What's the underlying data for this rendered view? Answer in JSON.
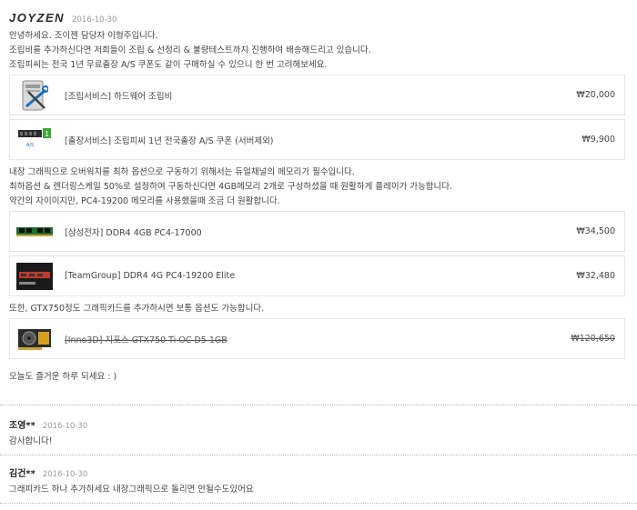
{
  "seller": {
    "logo": "JOYZEN",
    "date": "2016-10-30",
    "intro_lines": [
      "안녕하세요. 조이젠 담당자 이형주입니다.",
      "조립비를 추가하신다면 저희들이 조립 & 선정리 & 불량테스트까지 진행하여 배송해드리고 있습니다.",
      "조립피씨는 전국 1년 무료출장 A/S 쿠폰도 같이 구매하실 수 있으니 한 번 고려해보세요."
    ],
    "service_products": [
      {
        "name": "[조립서비스] 하드웨어 조립비",
        "price": "₩20,000",
        "icon": "assembly-tools-icon"
      },
      {
        "name": "[출장서비스] 조립피씨 1년 전국출장 A/S 쿠폰 (서버제외)",
        "price": "₩9,900",
        "icon": "as-coupon-icon"
      }
    ],
    "memory_lines": [
      "내장 그래픽으로 오버워치를 최하 옵션으로 구동하기 위해서는 듀얼채널의 메모리가 필수입니다.",
      "최하옵션 & 렌더링스케일 50%로 설정하여 구동하신다면 4GB메모리 2개로 구성하셨을 때 원활하게 플레이가 가능합니다.",
      "약간의 자이이지만, PC4-19200 메모리를 사용했을때 조금 더 원활합니다."
    ],
    "memory_products": [
      {
        "name": "[삼성전자] DDR4 4GB PC4-17000",
        "price": "₩34,500",
        "icon": "ram-stick-icon"
      },
      {
        "name": "[TeamGroup] DDR4 4G PC4-19200 Elite",
        "price": "₩32,480",
        "icon": "ram-box-icon"
      }
    ],
    "gpu_line": "또한, GTX750정도 그래픽카드를 추가하시면 보통 옵션도 가능합니다.",
    "gpu_product": {
      "name": "[Inno3D] 지포스 GTX750 Ti OC D5 1GB",
      "price": "₩120,650",
      "icon": "graphics-card-icon"
    },
    "closing": "오늘도 즐거운 하루 되세요 : )"
  },
  "comments": [
    {
      "name": "조영**",
      "date": "2016-10-30",
      "text": "감사합니다!"
    },
    {
      "name": "김건**",
      "date": "2016-10-30",
      "text": "그래피카드 하나 추가하세요 내장그래픽으로 돌리면 안될수도있어요"
    }
  ]
}
